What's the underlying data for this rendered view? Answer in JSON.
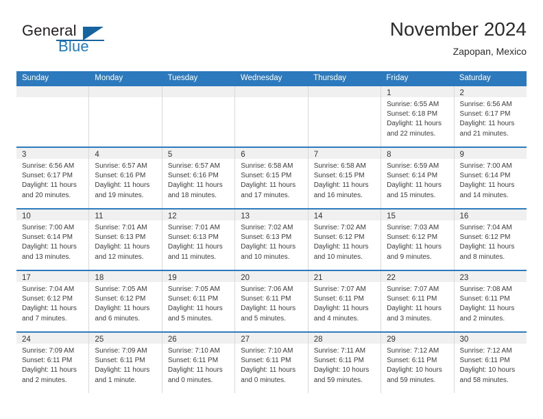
{
  "brand": {
    "name_part1": "General",
    "name_part2": "Blue",
    "triangle_color": "#15639f",
    "blue_color": "#1c7ac0"
  },
  "header": {
    "month_title": "November 2024",
    "location": "Zapopan, Mexico"
  },
  "theme": {
    "header_blue": "#2d79bd",
    "date_strip_gray": "#f0f0f0",
    "cell_border": "#d8d8d8"
  },
  "weekdays": [
    "Sunday",
    "Monday",
    "Tuesday",
    "Wednesday",
    "Thursday",
    "Friday",
    "Saturday"
  ],
  "weeks": [
    [
      {
        "day": "",
        "sunrise": "",
        "sunset": "",
        "daylight": ""
      },
      {
        "day": "",
        "sunrise": "",
        "sunset": "",
        "daylight": ""
      },
      {
        "day": "",
        "sunrise": "",
        "sunset": "",
        "daylight": ""
      },
      {
        "day": "",
        "sunrise": "",
        "sunset": "",
        "daylight": ""
      },
      {
        "day": "",
        "sunrise": "",
        "sunset": "",
        "daylight": ""
      },
      {
        "day": "1",
        "sunrise": "Sunrise: 6:55 AM",
        "sunset": "Sunset: 6:18 PM",
        "daylight": "Daylight: 11 hours and 22 minutes."
      },
      {
        "day": "2",
        "sunrise": "Sunrise: 6:56 AM",
        "sunset": "Sunset: 6:17 PM",
        "daylight": "Daylight: 11 hours and 21 minutes."
      }
    ],
    [
      {
        "day": "3",
        "sunrise": "Sunrise: 6:56 AM",
        "sunset": "Sunset: 6:17 PM",
        "daylight": "Daylight: 11 hours and 20 minutes."
      },
      {
        "day": "4",
        "sunrise": "Sunrise: 6:57 AM",
        "sunset": "Sunset: 6:16 PM",
        "daylight": "Daylight: 11 hours and 19 minutes."
      },
      {
        "day": "5",
        "sunrise": "Sunrise: 6:57 AM",
        "sunset": "Sunset: 6:16 PM",
        "daylight": "Daylight: 11 hours and 18 minutes."
      },
      {
        "day": "6",
        "sunrise": "Sunrise: 6:58 AM",
        "sunset": "Sunset: 6:15 PM",
        "daylight": "Daylight: 11 hours and 17 minutes."
      },
      {
        "day": "7",
        "sunrise": "Sunrise: 6:58 AM",
        "sunset": "Sunset: 6:15 PM",
        "daylight": "Daylight: 11 hours and 16 minutes."
      },
      {
        "day": "8",
        "sunrise": "Sunrise: 6:59 AM",
        "sunset": "Sunset: 6:14 PM",
        "daylight": "Daylight: 11 hours and 15 minutes."
      },
      {
        "day": "9",
        "sunrise": "Sunrise: 7:00 AM",
        "sunset": "Sunset: 6:14 PM",
        "daylight": "Daylight: 11 hours and 14 minutes."
      }
    ],
    [
      {
        "day": "10",
        "sunrise": "Sunrise: 7:00 AM",
        "sunset": "Sunset: 6:14 PM",
        "daylight": "Daylight: 11 hours and 13 minutes."
      },
      {
        "day": "11",
        "sunrise": "Sunrise: 7:01 AM",
        "sunset": "Sunset: 6:13 PM",
        "daylight": "Daylight: 11 hours and 12 minutes."
      },
      {
        "day": "12",
        "sunrise": "Sunrise: 7:01 AM",
        "sunset": "Sunset: 6:13 PM",
        "daylight": "Daylight: 11 hours and 11 minutes."
      },
      {
        "day": "13",
        "sunrise": "Sunrise: 7:02 AM",
        "sunset": "Sunset: 6:13 PM",
        "daylight": "Daylight: 11 hours and 10 minutes."
      },
      {
        "day": "14",
        "sunrise": "Sunrise: 7:02 AM",
        "sunset": "Sunset: 6:12 PM",
        "daylight": "Daylight: 11 hours and 10 minutes."
      },
      {
        "day": "15",
        "sunrise": "Sunrise: 7:03 AM",
        "sunset": "Sunset: 6:12 PM",
        "daylight": "Daylight: 11 hours and 9 minutes."
      },
      {
        "day": "16",
        "sunrise": "Sunrise: 7:04 AM",
        "sunset": "Sunset: 6:12 PM",
        "daylight": "Daylight: 11 hours and 8 minutes."
      }
    ],
    [
      {
        "day": "17",
        "sunrise": "Sunrise: 7:04 AM",
        "sunset": "Sunset: 6:12 PM",
        "daylight": "Daylight: 11 hours and 7 minutes."
      },
      {
        "day": "18",
        "sunrise": "Sunrise: 7:05 AM",
        "sunset": "Sunset: 6:12 PM",
        "daylight": "Daylight: 11 hours and 6 minutes."
      },
      {
        "day": "19",
        "sunrise": "Sunrise: 7:05 AM",
        "sunset": "Sunset: 6:11 PM",
        "daylight": "Daylight: 11 hours and 5 minutes."
      },
      {
        "day": "20",
        "sunrise": "Sunrise: 7:06 AM",
        "sunset": "Sunset: 6:11 PM",
        "daylight": "Daylight: 11 hours and 5 minutes."
      },
      {
        "day": "21",
        "sunrise": "Sunrise: 7:07 AM",
        "sunset": "Sunset: 6:11 PM",
        "daylight": "Daylight: 11 hours and 4 minutes."
      },
      {
        "day": "22",
        "sunrise": "Sunrise: 7:07 AM",
        "sunset": "Sunset: 6:11 PM",
        "daylight": "Daylight: 11 hours and 3 minutes."
      },
      {
        "day": "23",
        "sunrise": "Sunrise: 7:08 AM",
        "sunset": "Sunset: 6:11 PM",
        "daylight": "Daylight: 11 hours and 2 minutes."
      }
    ],
    [
      {
        "day": "24",
        "sunrise": "Sunrise: 7:09 AM",
        "sunset": "Sunset: 6:11 PM",
        "daylight": "Daylight: 11 hours and 2 minutes."
      },
      {
        "day": "25",
        "sunrise": "Sunrise: 7:09 AM",
        "sunset": "Sunset: 6:11 PM",
        "daylight": "Daylight: 11 hours and 1 minute."
      },
      {
        "day": "26",
        "sunrise": "Sunrise: 7:10 AM",
        "sunset": "Sunset: 6:11 PM",
        "daylight": "Daylight: 11 hours and 0 minutes."
      },
      {
        "day": "27",
        "sunrise": "Sunrise: 7:10 AM",
        "sunset": "Sunset: 6:11 PM",
        "daylight": "Daylight: 11 hours and 0 minutes."
      },
      {
        "day": "28",
        "sunrise": "Sunrise: 7:11 AM",
        "sunset": "Sunset: 6:11 PM",
        "daylight": "Daylight: 10 hours and 59 minutes."
      },
      {
        "day": "29",
        "sunrise": "Sunrise: 7:12 AM",
        "sunset": "Sunset: 6:11 PM",
        "daylight": "Daylight: 10 hours and 59 minutes."
      },
      {
        "day": "30",
        "sunrise": "Sunrise: 7:12 AM",
        "sunset": "Sunset: 6:11 PM",
        "daylight": "Daylight: 10 hours and 58 minutes."
      }
    ]
  ]
}
